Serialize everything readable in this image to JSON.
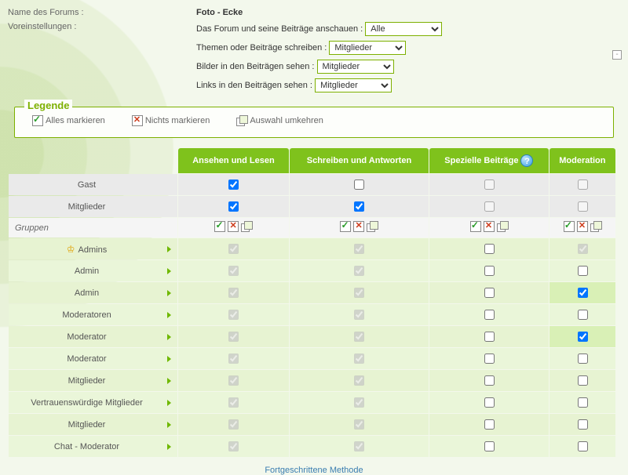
{
  "settings": {
    "name_label": "Name des Forums :",
    "name_value": "Foto - Ecke",
    "presets_label": "Voreinstellungen :",
    "view_forum_label": "Das Forum und seine Beiträge anschauen :",
    "view_forum_value": "Alle",
    "write_label": "Themen oder Beiträge schreiben :",
    "write_value": "Mitglieder",
    "images_label": "Bilder in den Beiträgen sehen :",
    "images_value": "Mitglieder",
    "links_label": "Links in den Beiträgen sehen :",
    "links_value": "Mitglieder",
    "collapse_glyph": "-"
  },
  "legend": {
    "title": "Legende",
    "all": "Alles markieren",
    "none": "Nichts markieren",
    "invert": "Auswahl umkehren"
  },
  "table": {
    "columns": [
      "Ansehen und Lesen",
      "Schreiben und Antworten",
      "Spezielle Beiträge",
      "Moderation"
    ],
    "help_glyph": "?",
    "rows": [
      {
        "kind": "role",
        "label": "Gast",
        "cells": [
          {
            "t": "cb",
            "c": true
          },
          {
            "t": "cb",
            "c": false
          },
          {
            "t": "cb",
            "c": false,
            "dim": true
          },
          {
            "t": "cb",
            "c": false,
            "dim": true
          }
        ]
      },
      {
        "kind": "role",
        "label": "Mitglieder",
        "cells": [
          {
            "t": "cb",
            "c": true
          },
          {
            "t": "cb",
            "c": true
          },
          {
            "t": "cb",
            "c": false,
            "dim": true
          },
          {
            "t": "cb",
            "c": false,
            "dim": true
          }
        ]
      },
      {
        "kind": "section",
        "label": "Gruppen",
        "cells": [
          {
            "t": "icons"
          },
          {
            "t": "icons"
          },
          {
            "t": "icons"
          },
          {
            "t": "icons"
          }
        ]
      },
      {
        "kind": "group",
        "label": "Admins",
        "admins": true,
        "cells": [
          {
            "t": "lcb",
            "c": true
          },
          {
            "t": "lcb",
            "c": true
          },
          {
            "t": "cb",
            "c": false
          },
          {
            "t": "lcb",
            "c": true
          }
        ]
      },
      {
        "kind": "group",
        "label": "Admin",
        "cells": [
          {
            "t": "lcb",
            "c": true
          },
          {
            "t": "lcb",
            "c": true
          },
          {
            "t": "cb",
            "c": false
          },
          {
            "t": "cb",
            "c": false
          }
        ]
      },
      {
        "kind": "group",
        "label": "Admin",
        "cells": [
          {
            "t": "lcb",
            "c": true
          },
          {
            "t": "lcb",
            "c": true
          },
          {
            "t": "cb",
            "c": false
          },
          {
            "t": "cb",
            "c": true,
            "hl": true
          }
        ]
      },
      {
        "kind": "group",
        "label": "Moderatoren",
        "cells": [
          {
            "t": "lcb",
            "c": true
          },
          {
            "t": "lcb",
            "c": true
          },
          {
            "t": "cb",
            "c": false
          },
          {
            "t": "cb",
            "c": false
          }
        ]
      },
      {
        "kind": "group",
        "label": "Moderator",
        "cells": [
          {
            "t": "lcb",
            "c": true
          },
          {
            "t": "lcb",
            "c": true
          },
          {
            "t": "cb",
            "c": false
          },
          {
            "t": "cb",
            "c": true,
            "hl": true
          }
        ]
      },
      {
        "kind": "group",
        "label": "Moderator",
        "cells": [
          {
            "t": "lcb",
            "c": true
          },
          {
            "t": "lcb",
            "c": true
          },
          {
            "t": "cb",
            "c": false
          },
          {
            "t": "cb",
            "c": false
          }
        ]
      },
      {
        "kind": "group",
        "label": "Mitglieder",
        "cells": [
          {
            "t": "lcb",
            "c": true
          },
          {
            "t": "lcb",
            "c": true
          },
          {
            "t": "cb",
            "c": false
          },
          {
            "t": "cb",
            "c": false
          }
        ]
      },
      {
        "kind": "group",
        "label": "Vertrauenswürdige Mitglieder",
        "cells": [
          {
            "t": "lcb",
            "c": true
          },
          {
            "t": "lcb",
            "c": true
          },
          {
            "t": "cb",
            "c": false
          },
          {
            "t": "cb",
            "c": false
          }
        ]
      },
      {
        "kind": "group",
        "label": "Mitglieder",
        "cells": [
          {
            "t": "lcb",
            "c": true
          },
          {
            "t": "lcb",
            "c": true
          },
          {
            "t": "cb",
            "c": false
          },
          {
            "t": "cb",
            "c": false
          }
        ]
      },
      {
        "kind": "group",
        "label": "Chat - Moderator",
        "cells": [
          {
            "t": "lcb",
            "c": true
          },
          {
            "t": "lcb",
            "c": true
          },
          {
            "t": "cb",
            "c": false
          },
          {
            "t": "cb",
            "c": false
          }
        ]
      }
    ]
  },
  "footer_link": "Fortgeschrittene Methode"
}
